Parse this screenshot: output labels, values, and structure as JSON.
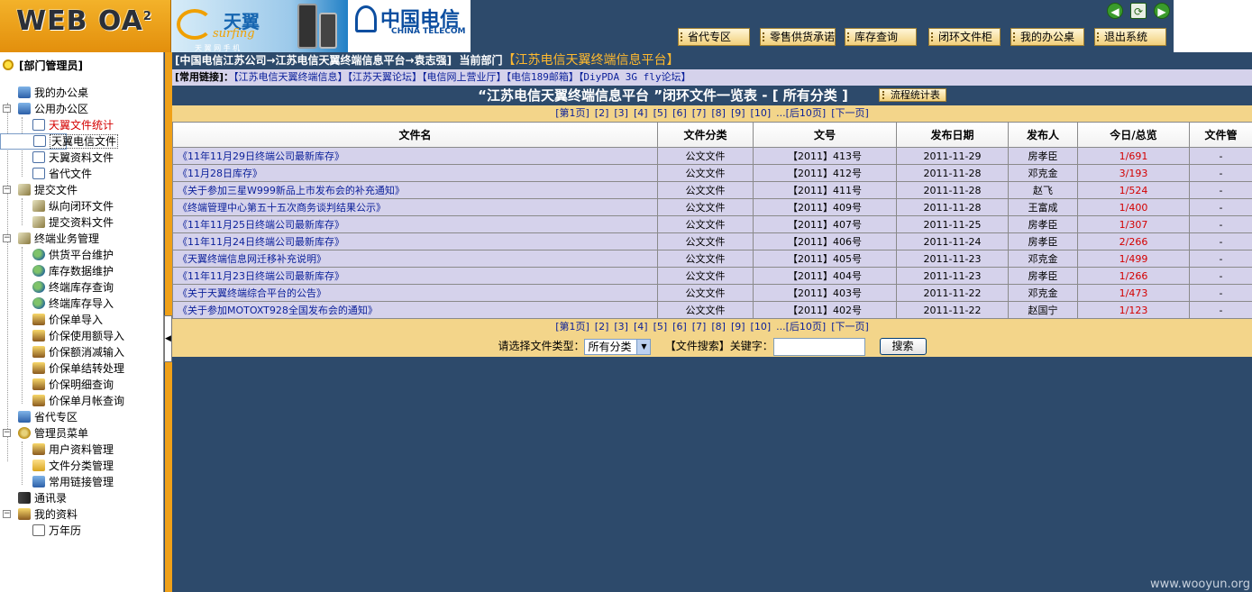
{
  "app": {
    "logo_text": "WEB OA",
    "logo_sup": "2"
  },
  "banner": {
    "brand_cn": "天翼",
    "brand_en": "surfing",
    "brand_sub": "天 翼 网 手 机",
    "carrier_cn": "中国电信",
    "carrier_en": "CHINA TELECOM"
  },
  "top_buttons": [
    {
      "label": "省代专区"
    },
    {
      "label": "零售供货承诺"
    },
    {
      "label": "库存查询"
    },
    {
      "label": "闭环文件柜"
    },
    {
      "label": "我的办公桌"
    },
    {
      "label": "退出系统"
    }
  ],
  "sidebar": {
    "role": "[部门管理员]",
    "items": [
      {
        "label": "我的办公桌",
        "icon": "pc-icon"
      },
      {
        "label": "公用办公区",
        "icon": "pc-icon"
      },
      {
        "label": "天翼文件统计",
        "icon": "doc-icon"
      },
      {
        "label": "天翼电信文件",
        "icon": "doc-icon"
      },
      {
        "label": "天翼资料文件",
        "icon": "doc-icon"
      },
      {
        "label": "省代文件",
        "icon": "doc-icon"
      },
      {
        "label": "提交文件",
        "icon": "pen-icon"
      },
      {
        "label": "纵向闭环文件",
        "icon": "pen-icon"
      },
      {
        "label": "提交资料文件",
        "icon": "pen-icon"
      },
      {
        "label": "终端业务管理",
        "icon": "pen-icon"
      },
      {
        "label": "供货平台维护",
        "icon": "people-icon"
      },
      {
        "label": "库存数据维护",
        "icon": "people-icon"
      },
      {
        "label": "终端库存查询",
        "icon": "people-icon"
      },
      {
        "label": "终端库存导入",
        "icon": "people-icon"
      },
      {
        "label": "价保单导入",
        "icon": "money-icon"
      },
      {
        "label": "价保使用额导入",
        "icon": "money-icon"
      },
      {
        "label": "价保额消减输入",
        "icon": "money-icon"
      },
      {
        "label": "价保单结转处理",
        "icon": "money-icon"
      },
      {
        "label": "价保明细查询",
        "icon": "money-icon"
      },
      {
        "label": "价保单月帐查询",
        "icon": "money-icon"
      },
      {
        "label": "省代专区",
        "icon": "pc-icon"
      },
      {
        "label": "管理员菜单",
        "icon": "gear-icon"
      },
      {
        "label": "用户资料管理",
        "icon": "money-icon"
      },
      {
        "label": "文件分类管理",
        "icon": "folder-icon"
      },
      {
        "label": "常用链接管理",
        "icon": "pc-icon"
      },
      {
        "label": "通讯录",
        "icon": "book-icon"
      },
      {
        "label": "我的资料",
        "icon": "money-icon"
      },
      {
        "label": "万年历",
        "icon": "calendar-icon"
      }
    ]
  },
  "breadcrumb": {
    "path": "[中国电信江苏公司→江苏电信天翼终端信息平台→袁志强]",
    "dept_label": "当前部门",
    "dept": "【江苏电信天翼终端信息平台】"
  },
  "links": {
    "label": "[常用链接]：",
    "items": [
      "【江苏电信天翼终端信息】",
      "【江苏天翼论坛】",
      "【电信网上营业厅】",
      "【电信189邮箱】",
      "【DiyPDA 3G fly论坛】"
    ]
  },
  "page_title": "“江苏电信天翼终端信息平台 ”闭环文件一览表 - [ 所有分类 ]",
  "flow_button": "流程统计表",
  "pager": [
    "[第1页]",
    "[2]",
    "[3]",
    "[4]",
    "[5]",
    "[6]",
    "[7]",
    "[8]",
    "[9]",
    "[10]",
    "...[后10页]",
    "[下一页]"
  ],
  "table": {
    "headers": [
      "文件名",
      "文件分类",
      "文号",
      "发布日期",
      "发布人",
      "今日/总览",
      "文件管"
    ],
    "rows": [
      [
        "《11年11月29日终端公司最新库存》",
        "公文文件",
        "【2011】413号",
        "2011-11-29",
        "房孝臣",
        "1/691",
        "-"
      ],
      [
        "《11月28日库存》",
        "公文文件",
        "【2011】412号",
        "2011-11-28",
        "邓克金",
        "3/193",
        "-"
      ],
      [
        "《关于参加三星W999新品上市发布会的补充通知》",
        "公文文件",
        "【2011】411号",
        "2011-11-28",
        "赵飞",
        "1/524",
        "-"
      ],
      [
        "《终端管理中心第五十五次商务谈判结果公示》",
        "公文文件",
        "【2011】409号",
        "2011-11-28",
        "王富成",
        "1/400",
        "-"
      ],
      [
        "《11年11月25日终端公司最新库存》",
        "公文文件",
        "【2011】407号",
        "2011-11-25",
        "房孝臣",
        "1/307",
        "-"
      ],
      [
        "《11年11月24日终端公司最新库存》",
        "公文文件",
        "【2011】406号",
        "2011-11-24",
        "房孝臣",
        "2/266",
        "-"
      ],
      [
        "《天翼终端信息网迁移补充说明》",
        "公文文件",
        "【2011】405号",
        "2011-11-23",
        "邓克金",
        "1/499",
        "-"
      ],
      [
        "《11年11月23日终端公司最新库存》",
        "公文文件",
        "【2011】404号",
        "2011-11-23",
        "房孝臣",
        "1/266",
        "-"
      ],
      [
        "《关于天翼终端综合平台的公告》",
        "公文文件",
        "【2011】403号",
        "2011-11-22",
        "邓克金",
        "1/473",
        "-"
      ],
      [
        "《关于参加MOTOXT928全国发布会的通知》",
        "公文文件",
        "【2011】402号",
        "2011-11-22",
        "赵国宁",
        "1/123",
        "-"
      ]
    ]
  },
  "search": {
    "type_label": "请选择文件类型：",
    "type_value": "所有分类",
    "kw_label": "【文件搜索】关键字：",
    "kw_value": "",
    "button": "搜索"
  },
  "watermark": "www.wooyun.org"
}
